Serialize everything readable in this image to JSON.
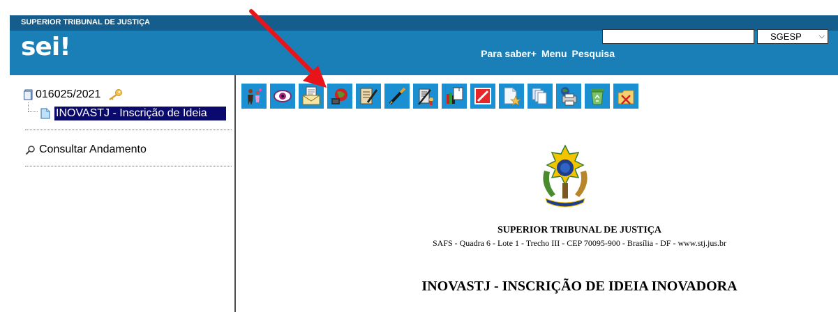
{
  "header": {
    "org_name": "SUPERIOR TRIBUNAL DE JUSTIÇA",
    "logo": "sei",
    "logo_mark": "!",
    "nav": [
      "Para saber+",
      "Menu",
      "Pesquisa"
    ],
    "search_value": "",
    "unit_select": "SGESP",
    "colors": {
      "header_bg": "#1a7fb6",
      "header_bar": "#155d8c",
      "toolbar_icon_bg": "#1a8fd1",
      "selection": "#0a0a6e"
    }
  },
  "sidebar": {
    "process_number": "016025/2021",
    "document_label": "INOVASTJ - Inscrição de Ideia",
    "consult_label": "Consultar Andamento"
  },
  "toolbar": {
    "icons": [
      "add-participant-icon",
      "view-icon",
      "send-email-icon",
      "send-process-icon",
      "edit-document-icon",
      "sign-icon",
      "authenticate-icon",
      "include-block-icon",
      "cancel-icon",
      "new-favorite-icon",
      "copy-icon",
      "print-icon",
      "recycle-icon",
      "delete-icon"
    ]
  },
  "document": {
    "court_title": "SUPERIOR TRIBUNAL DE JUSTIÇA",
    "court_address": "SAFS - Quadra 6 - Lote 1 - Trecho III - CEP 70095-900 - Brasília - DF - www.stj.jus.br",
    "title": "INOVASTJ - INSCRIÇÃO DE IDEIA INOVADORA"
  }
}
